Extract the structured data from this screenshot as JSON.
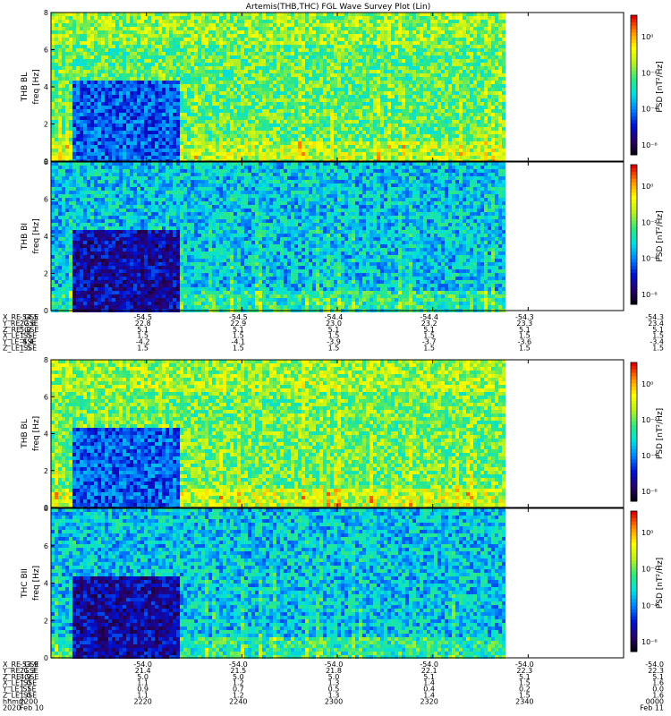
{
  "title": "Artemis(THB,THC) FGL Wave Survey Plot (Lin)",
  "chart_data": {
    "type": "heatmap",
    "colormap": [
      "#000000",
      "#2a0066",
      "#0010d0",
      "#0080ff",
      "#00e0e0",
      "#30e880",
      "#b8f020",
      "#ffff00",
      "#ff9000",
      "#e00000"
    ],
    "freq_range": [
      0,
      8
    ],
    "time_range_hhmm": [
      "2200",
      "0000"
    ],
    "data_coverage_fraction": 0.79,
    "panels": [
      {
        "ylabel": "THB BL",
        "yunit": "freq [Hz]",
        "yticks": [
          "0",
          "2",
          "4",
          "6",
          "8"
        ],
        "cbar_label": "PSD [nT²/Hz]",
        "cbar_ticks": [
          "10⁰",
          "10⁻²",
          "10⁻⁴",
          "10⁻⁶"
        ],
        "quiet_end_fraction": 0.22,
        "base_level": 0.42,
        "active_level": 0.58
      },
      {
        "ylabel": "THB BI",
        "yunit": "freq [Hz]",
        "yticks": [
          "0",
          "2",
          "4",
          "6",
          "8"
        ],
        "cbar_label": "PSD [nT²/Hz]",
        "cbar_ticks": [
          "10⁰",
          "10⁻²",
          "10⁻⁴",
          "10⁻⁶"
        ],
        "quiet_end_fraction": 0.22,
        "base_level": 0.3,
        "active_level": 0.42
      },
      {
        "ylabel": "THB BL",
        "yunit": "freq [Hz]",
        "yticks": [
          "0",
          "2",
          "4",
          "6",
          "8"
        ],
        "cbar_label": "PSD [nT²/Hz]",
        "cbar_ticks": [
          "10⁰",
          "10⁻²",
          "10⁻⁴",
          "10⁻⁶"
        ],
        "quiet_end_fraction": 0.22,
        "base_level": 0.42,
        "active_level": 0.6
      },
      {
        "ylabel": "THC BII",
        "yunit": "freq [Hz]",
        "yticks": [
          "0",
          "2",
          "4",
          "6",
          "8"
        ],
        "cbar_label": "PSD [nT²/Hz]",
        "cbar_ticks": [
          "10⁰",
          "10⁻²",
          "10⁻⁴",
          "10⁻⁶"
        ],
        "quiet_end_fraction": 0.22,
        "base_level": 0.3,
        "active_level": 0.42
      }
    ]
  },
  "ephemeris_top": {
    "labels": [
      "X_RE_GSE",
      "Y_RE_GSE",
      "Z_RE_GSE",
      "X_LE_SSE",
      "Y_LE_SSE",
      "Z_LE_SSE"
    ],
    "columns": [
      [
        "-54.5",
        "22.6",
        "5.0",
        "1.5",
        "-4.4",
        "1.5"
      ],
      [
        "-54.5",
        "22.8",
        "5.1",
        "1.5",
        "-4.2",
        "1.5"
      ],
      [
        "-54.5",
        "22.9",
        "5.1",
        "1.5",
        "-4.1",
        "1.5"
      ],
      [
        "-54.4",
        "23.0",
        "5.1",
        "1.5",
        "-3.9",
        "1.5"
      ],
      [
        "-54.4",
        "23.2",
        "5.1",
        "1.5",
        "-3.7",
        "1.5"
      ],
      [
        "-54.3",
        "23.3",
        "5.1",
        "1.5",
        "-3.6",
        "1.5"
      ],
      [
        "-54.3",
        "23.4",
        "5.1",
        "1.5",
        "-3.4",
        "1.5"
      ]
    ]
  },
  "ephemeris_bottom": {
    "labels": [
      "X_RE_GSE",
      "Y_RE_GSE",
      "Z_RE_GSE",
      "X_LE_SSE",
      "Y_LE_SSE",
      "Z_LE_SSE",
      "hhmm",
      "2020"
    ],
    "columns": [
      [
        "-53.9",
        "21.3",
        "4.9",
        "1.0",
        "1.1",
        "1.0",
        "2200",
        "Feb 10"
      ],
      [
        "-54.0",
        "21.4",
        "5.0",
        "1.1",
        "0.9",
        "1.1",
        "2220",
        ""
      ],
      [
        "-54.0",
        "21.5",
        "5.0",
        "1.2",
        "0.7",
        "1.2",
        "2240",
        ""
      ],
      [
        "-54.0",
        "21.8",
        "5.0",
        "1.3",
        "0.5",
        "1.3",
        "2300",
        ""
      ],
      [
        "-54.0",
        "22.1",
        "5.1",
        "1.4",
        "0.4",
        "1.4",
        "2320",
        ""
      ],
      [
        "-54.0",
        "22.3",
        "5.1",
        "1.5",
        "0.2",
        "1.5",
        "2340",
        ""
      ],
      [
        "-54.0",
        "22.3",
        "5.1",
        "1.6",
        "0.0",
        "1.6",
        "0000",
        "Feb 11"
      ]
    ]
  }
}
